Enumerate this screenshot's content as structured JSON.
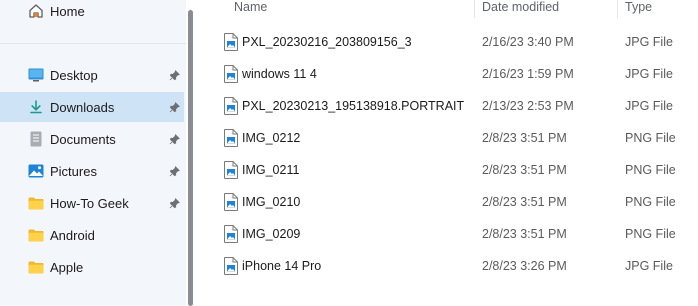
{
  "sidebar": {
    "home": {
      "label": "Home",
      "icon": "home-icon"
    },
    "items": [
      {
        "label": "Desktop",
        "icon": "desktop-icon",
        "pinned": true,
        "selected": false
      },
      {
        "label": "Downloads",
        "icon": "download-icon",
        "pinned": true,
        "selected": true
      },
      {
        "label": "Documents",
        "icon": "document-icon",
        "pinned": true,
        "selected": false
      },
      {
        "label": "Pictures",
        "icon": "picture-icon",
        "pinned": true,
        "selected": false
      },
      {
        "label": "How-To Geek",
        "icon": "folder-icon",
        "pinned": true,
        "selected": false
      },
      {
        "label": "Android",
        "icon": "folder-icon",
        "pinned": false,
        "selected": false
      },
      {
        "label": "Apple",
        "icon": "folder-icon",
        "pinned": false,
        "selected": false
      }
    ]
  },
  "columns": {
    "name": "Name",
    "date": "Date modified",
    "type": "Type"
  },
  "files": [
    {
      "name": "PXL_20230216_203809156_3",
      "date": "2/16/23 3:40 PM",
      "type": "JPG File"
    },
    {
      "name": "windows 11 4",
      "date": "2/16/23 1:59 PM",
      "type": "JPG File"
    },
    {
      "name": "PXL_20230213_195138918.PORTRAIT",
      "date": "2/13/23 2:53 PM",
      "type": "JPG File"
    },
    {
      "name": "IMG_0212",
      "date": "2/8/23 3:51 PM",
      "type": "PNG File"
    },
    {
      "name": "IMG_0211",
      "date": "2/8/23 3:51 PM",
      "type": "PNG File"
    },
    {
      "name": "IMG_0210",
      "date": "2/8/23 3:51 PM",
      "type": "PNG File"
    },
    {
      "name": "IMG_0209",
      "date": "2/8/23 3:51 PM",
      "type": "PNG File"
    },
    {
      "name": "iPhone 14 Pro",
      "date": "2/8/23 3:26 PM",
      "type": "JPG File"
    }
  ],
  "colors": {
    "selected_bg": "#cfe3f7",
    "sidebar_bg": "#f3f6fb",
    "accent": "#0067c0"
  }
}
